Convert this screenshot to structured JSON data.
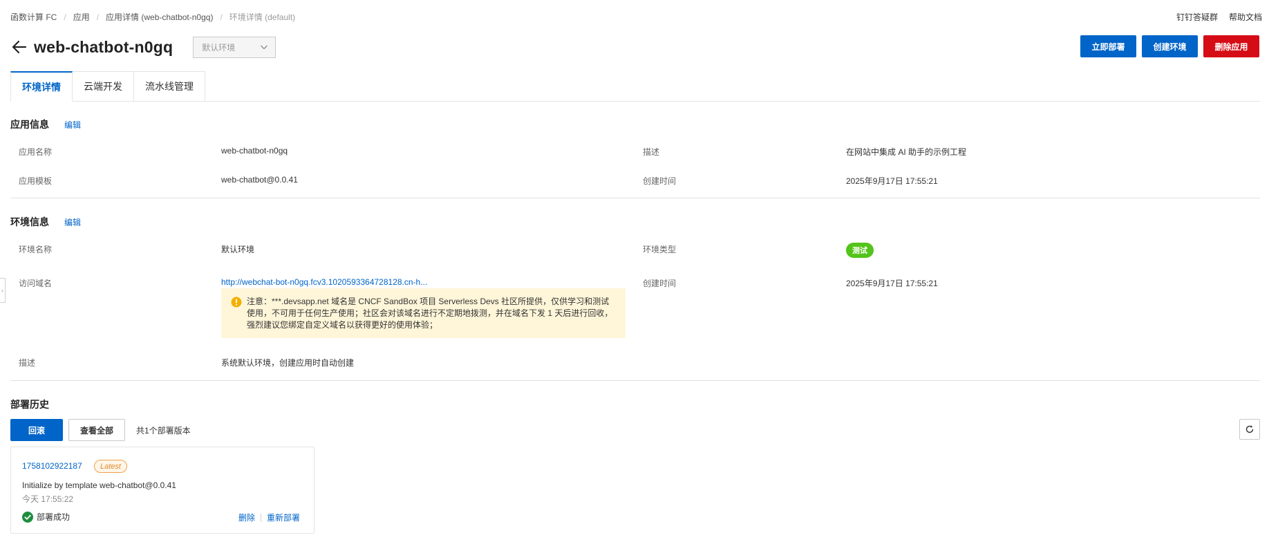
{
  "breadcrumb": {
    "items": [
      "函数计算 FC",
      "应用",
      "应用详情 (web-chatbot-n0gq)"
    ],
    "current": "环境详情 (default)"
  },
  "top_links": {
    "dingtalk": "钉钉答疑群",
    "help": "帮助文档"
  },
  "header": {
    "title": "web-chatbot-n0gq",
    "env_select": {
      "value": "默认环境",
      "icon": "chevron-down-icon"
    }
  },
  "actions": {
    "deploy": "立即部署",
    "create_env": "创建环境",
    "delete_app": "删除应用"
  },
  "tabs": [
    {
      "label": "环境详情",
      "active": true
    },
    {
      "label": "云端开发",
      "active": false
    },
    {
      "label": "流水线管理",
      "active": false
    }
  ],
  "app_info": {
    "title": "应用信息",
    "edit": "编辑",
    "name_label": "应用名称",
    "name_value": "web-chatbot-n0gq",
    "desc_label": "描述",
    "desc_value": "在网站中集成 AI 助手的示例工程",
    "template_label": "应用模板",
    "template_value": "web-chatbot@0.0.41",
    "created_label": "创建时间",
    "created_value": "2025年9月17日 17:55:21"
  },
  "env_info": {
    "title": "环境信息",
    "edit": "编辑",
    "name_label": "环境名称",
    "name_value": "默认环境",
    "type_label": "环境类型",
    "type_value": "测试",
    "domain_label": "访问域名",
    "domain_value": "http://webchat-bot-n0gq.fcv3.1020593364728128.cn-h...",
    "created_label": "创建时间",
    "created_value": "2025年9月17日 17:55:21",
    "notice": "注意：***.devsapp.net 域名是 CNCF SandBox 项目 Serverless Devs 社区所提供，仅供学习和测试使用，不可用于任何生产使用；社区会对该域名进行不定期地拨测，并在域名下发 1 天后进行回收，强烈建议您绑定自定义域名以获得更好的使用体验；",
    "desc_label": "描述",
    "desc_value": "系统默认环境，创建应用时自动创建"
  },
  "deploy_history": {
    "title": "部署历史",
    "rollback": "回滚",
    "view_all": "查看全部",
    "count_text": "共1个部署版本",
    "card": {
      "id": "1758102922187",
      "tag": "Latest",
      "desc": "Initialize by template web-chatbot@0.0.41",
      "time": "今天 17:55:22",
      "status": "部署成功",
      "delete": "删除",
      "redeploy": "重新部署"
    }
  },
  "colors": {
    "primary": "#0064c8",
    "danger": "#d50b16",
    "success": "#52c41a",
    "notice_bg": "#fff6d9"
  }
}
